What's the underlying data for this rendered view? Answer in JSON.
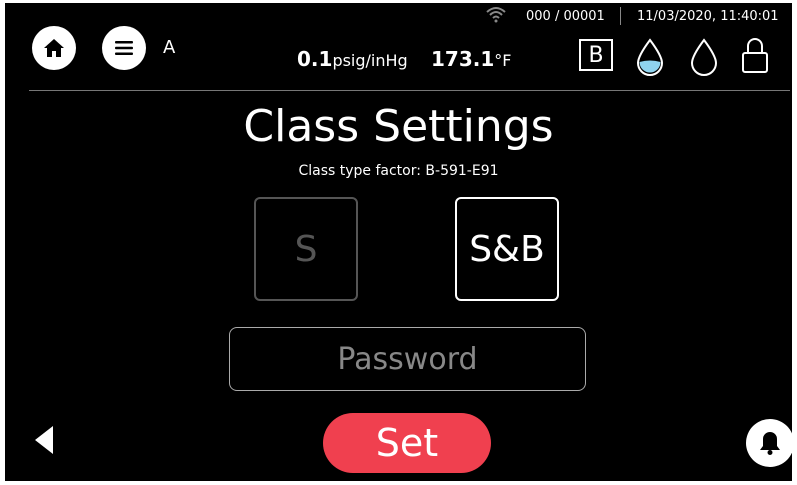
{
  "header": {
    "user": "A",
    "counter": "000 / 00001",
    "datetime": "11/03/2020, 11:40:01",
    "pressure_value": "0.1",
    "pressure_unit": "psig/inHg",
    "temp_value": "173.1",
    "temp_unit": "°F",
    "class_badge": "B"
  },
  "main": {
    "title": "Class Settings",
    "subtitle": "Class type factor: B-591-E91",
    "options": [
      {
        "label": "S",
        "state": "disabled"
      },
      {
        "label": "S&B",
        "state": "selected"
      }
    ],
    "password_placeholder": "Password",
    "set_label": "Set"
  },
  "icons": [
    "home-icon",
    "menu-icon",
    "wifi-icon",
    "water-drop-full-icon",
    "water-drop-empty-icon",
    "lock-icon",
    "back-arrow-icon",
    "bell-icon"
  ],
  "colors": {
    "background": "#000000",
    "accent": "#f0404f",
    "water": "#8fd3ee",
    "disabled": "#555555"
  }
}
